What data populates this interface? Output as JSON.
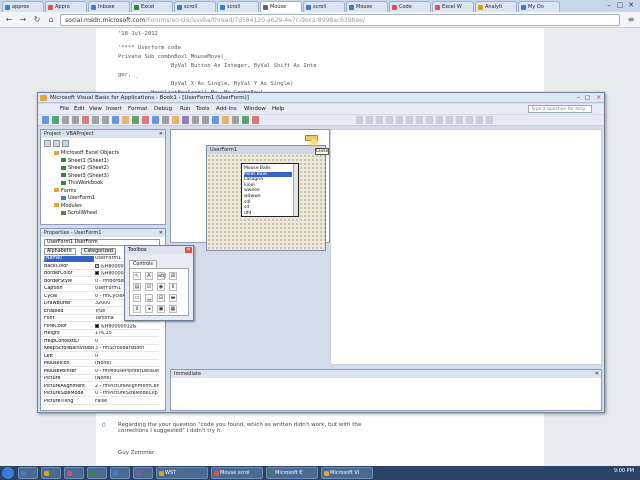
{
  "browser": {
    "tabs": [
      {
        "label": "approx",
        "color": "#3a7bd5"
      },
      {
        "label": "Appro",
        "color": "#d9534f"
      },
      {
        "label": "Inboxe",
        "color": "#3a7bd5"
      },
      {
        "label": "Excel",
        "color": "#2f8a3e"
      },
      {
        "label": "scroll",
        "color": "#3a7bd5"
      },
      {
        "label": "scroll",
        "color": "#3a7bd5"
      },
      {
        "label": "Mouse",
        "color": "#666"
      },
      {
        "label": "scroll",
        "color": "#3a7bd5"
      },
      {
        "label": "Mouse",
        "color": "#3a7bd5"
      },
      {
        "label": "Code",
        "color": "#d9534f"
      },
      {
        "label": "Excel W",
        "color": "#d9534f"
      },
      {
        "label": "Analyti",
        "color": "#e2a100"
      },
      {
        "label": "My Do",
        "color": "#3a7bd5"
      }
    ],
    "url_host": "social.msdn.microsoft.com",
    "url_path": "/Forums/en-US/isvvba/thread/7d584120-a629-4e7c-9ec2-8998ac639bee/",
    "window_buttons": [
      "–",
      "□",
      "✕"
    ]
  },
  "page": {
    "date_line": "'18-Jul-2012",
    "code_lines": [
      "'**** Userform code",
      "Private Sub comboBoxl_MouseMove(_",
      "                ByVal Button As Integer, ByVal Shift As Inte",
      "ger, _",
      "                ByVal X As Single, ByVal Y As Single)",
      "          HookListBoxScroll Me, Me.ComboBoxl"
    ],
    "reply_text": "Regarding the your question \"code you found, which as written didn't work, but with the corrections I suggested\" I didn't try it.",
    "reply_marker": "0",
    "signature": "Guy Zommer"
  },
  "vbe": {
    "title": "Microsoft Visual Basic for Applications - Book1 - [UserForm1 (UserForm)]",
    "menu": [
      "File",
      "Edit",
      "View",
      "Insert",
      "Format",
      "Debug",
      "Run",
      "Tools",
      "Add-Ins",
      "Window",
      "Help"
    ],
    "ask_placeholder": "Type a question for help",
    "project": {
      "title": "Project - VBAProject",
      "tree": [
        {
          "label": "Microsoft Excel Objects",
          "indent": 1,
          "color": "#e6a339"
        },
        {
          "label": "Sheet1 (Sheet1)",
          "indent": 2,
          "color": "#2f8a3e"
        },
        {
          "label": "Sheet2 (Sheet2)",
          "indent": 2,
          "color": "#2f8a3e"
        },
        {
          "label": "Sheet3 (Sheet3)",
          "indent": 2,
          "color": "#2f8a3e"
        },
        {
          "label": "ThisWorkbook",
          "indent": 2,
          "color": "#2f8a3e"
        },
        {
          "label": "Forms",
          "indent": 1,
          "color": "#e6a339"
        },
        {
          "label": "UserForm1",
          "indent": 2,
          "color": "#3a7bd5"
        },
        {
          "label": "Modules",
          "indent": 1,
          "color": "#e6a339"
        },
        {
          "label": "ScrollWheel",
          "indent": 2,
          "color": "#8a6d3b"
        }
      ]
    },
    "properties": {
      "title": "Properties - UserForm1",
      "object": "UserForm1 UserForm",
      "tabs": [
        "Alphabetic",
        "Categorized"
      ],
      "rows": [
        {
          "k": "(Name)",
          "v": "UserForm1",
          "sel": true
        },
        {
          "k": "BackColor",
          "v": "&H8000000F&",
          "swatch": "#d4d0c8"
        },
        {
          "k": "BorderColor",
          "v": "&H80000012&",
          "swatch": "#000000"
        },
        {
          "k": "BorderStyle",
          "v": "0 - fmBorderSt"
        },
        {
          "k": "Caption",
          "v": "UserForm1"
        },
        {
          "k": "Cycle",
          "v": "0 - fmCycleAllF"
        },
        {
          "k": "DrawBuffer",
          "v": "32000"
        },
        {
          "k": "Enabled",
          "v": "True"
        },
        {
          "k": "Font",
          "v": "Tahoma"
        },
        {
          "k": "ForeColor",
          "v": "&H80000012&",
          "swatch": "#000000"
        },
        {
          "k": "Height",
          "v": "176.25"
        },
        {
          "k": "HelpContextID",
          "v": "0"
        },
        {
          "k": "KeepScrollBarsVisible",
          "v": "3 - fmScrollBarsBoth"
        },
        {
          "k": "Left",
          "v": "0"
        },
        {
          "k": "MouseIcon",
          "v": "(None)"
        },
        {
          "k": "MousePointer",
          "v": "0 - fmMousePointerDefault"
        },
        {
          "k": "Picture",
          "v": "(None)"
        },
        {
          "k": "PictureAlignment",
          "v": "2 - fmPictureAlignmentCent"
        },
        {
          "k": "PictureSizeMode",
          "v": "0 - fmPictureSizeModeClip"
        },
        {
          "k": "PictureTiling",
          "v": "False"
        }
      ]
    },
    "userform": {
      "title": "UserForm1",
      "list": [
        "Moose Balls",
        "Meat Balls",
        "Lasagna",
        "kiool",
        "wweee",
        "wdwwe",
        "sdl",
        "sd",
        "dfd"
      ],
      "selected_index": 1,
      "tooltip": "Close"
    },
    "toolbox": {
      "title": "Toolbox",
      "tab": "Controls",
      "tools": [
        "↖",
        "A",
        "ab|",
        "⊞",
        "▤",
        "☑",
        "◉",
        "⊻",
        "▭",
        "▁",
        "⊟",
        "▬",
        "⇕",
        "◂",
        "▣",
        "▦"
      ]
    },
    "immediate": {
      "title": "Immediate"
    }
  },
  "taskbar": {
    "items": [
      {
        "label": "",
        "color": "#3d7bd6"
      },
      {
        "label": "",
        "color": "#e2a100"
      },
      {
        "label": "",
        "color": "#d9534f"
      },
      {
        "label": "",
        "color": "#2f8a3e"
      },
      {
        "label": "",
        "color": "#3d7bd6"
      },
      {
        "label": "",
        "color": "#7a5ba8"
      },
      {
        "label": "WST",
        "color": "#e2a100"
      },
      {
        "label": "Mouse scrol",
        "color": "#d9534f"
      },
      {
        "label": "Microsoft E",
        "color": "#2f8a3e"
      },
      {
        "label": "Microsoft Vi",
        "color": "#e6a339"
      }
    ],
    "clock": "9:00 PM"
  }
}
